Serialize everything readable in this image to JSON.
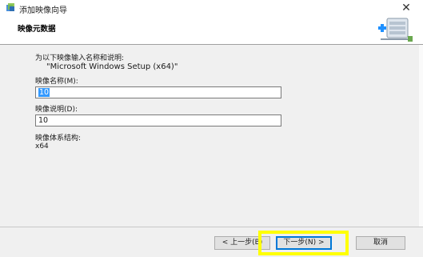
{
  "window": {
    "title": "添加映像向导",
    "close_symbol": "✕"
  },
  "header": {
    "title": "映像元数据"
  },
  "content": {
    "intro_line": "为以下映像输入名称和说明:",
    "image_source": "\"Microsoft Windows Setup (x64)\"",
    "image_name_label": "映像名称(M):",
    "image_name_value": "10",
    "image_desc_label": "映像说明(D):",
    "image_desc_value": "10",
    "arch_label": "映像体系结构:",
    "arch_value": "x64"
  },
  "buttons": {
    "back": "< 上一步(B)",
    "next": "下一步(N) >",
    "cancel": "取消"
  },
  "colors": {
    "highlight": "#ffff00",
    "selection": "#3399ff",
    "focus": "#0078d7"
  },
  "icons": [
    "wizard-app-icon",
    "close-icon",
    "server-network-icon"
  ]
}
